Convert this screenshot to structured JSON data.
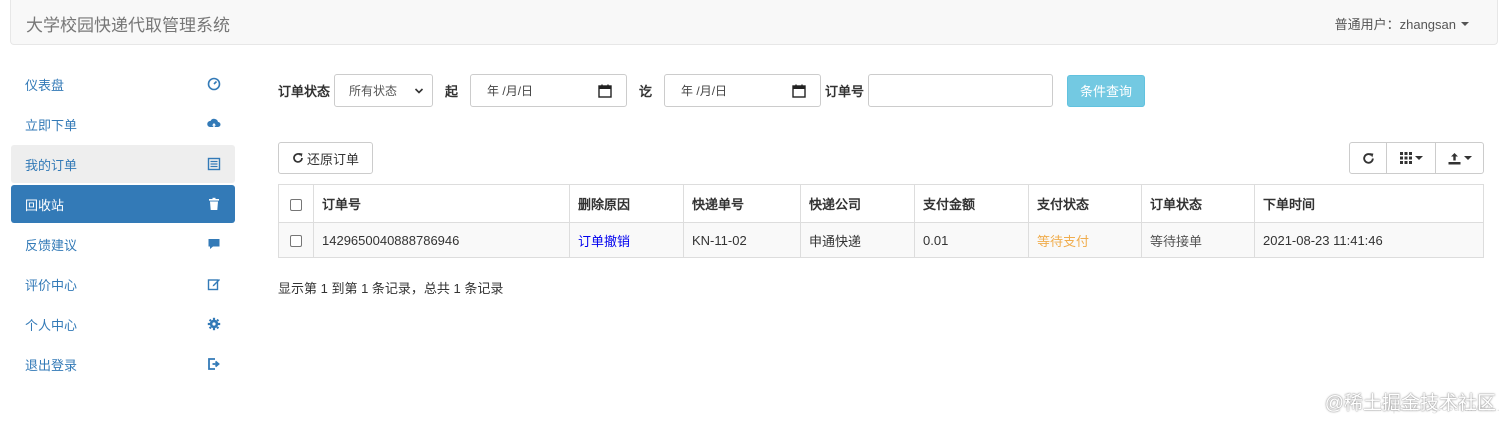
{
  "app": {
    "title": "大学校园快递代取管理系统",
    "user_label": "普通用户：zhangsan"
  },
  "sidebar": {
    "items": [
      {
        "label": "仪表盘",
        "icon": "dashboard-icon"
      },
      {
        "label": "立即下单",
        "icon": "cloud-upload-icon"
      },
      {
        "label": "我的订单",
        "icon": "list-icon"
      },
      {
        "label": "回收站",
        "icon": "trash-icon"
      },
      {
        "label": "反馈建议",
        "icon": "comment-icon"
      },
      {
        "label": "评价中心",
        "icon": "edit-icon"
      },
      {
        "label": "个人中心",
        "icon": "gear-icon"
      },
      {
        "label": "退出登录",
        "icon": "logout-icon"
      }
    ]
  },
  "filters": {
    "order_status_label": "订单状态",
    "order_status_value": "所有状态",
    "from_label": "起",
    "from_date": "年 /月/日",
    "to_label": "讫",
    "to_date": "年 /月/日",
    "order_no_label": "订单号",
    "order_no_value": "",
    "query_button": "条件查询"
  },
  "toolbar": {
    "restore_button": "还原订单"
  },
  "table": {
    "headers": [
      "订单号",
      "删除原因",
      "快递单号",
      "快递公司",
      "支付金额",
      "支付状态",
      "订单状态",
      "下单时间"
    ],
    "rows": [
      [
        "1429650040888786946",
        "订单撤销",
        "KN-11-02",
        "申通快递",
        "0.01",
        "等待支付",
        "等待接单",
        "2021-08-23 11:41:46"
      ]
    ]
  },
  "pagination": {
    "summary": "显示第 1 到第 1 条记录，总共 1 条记录"
  },
  "watermark": {
    "text": "@稀土掘金技术社区",
    "url": "https://blog.csdn.net/..."
  },
  "colors": {
    "primary": "#337ab7",
    "info": "#5bc0de",
    "warning": "#f0ad4e",
    "link": "#0000ee"
  }
}
